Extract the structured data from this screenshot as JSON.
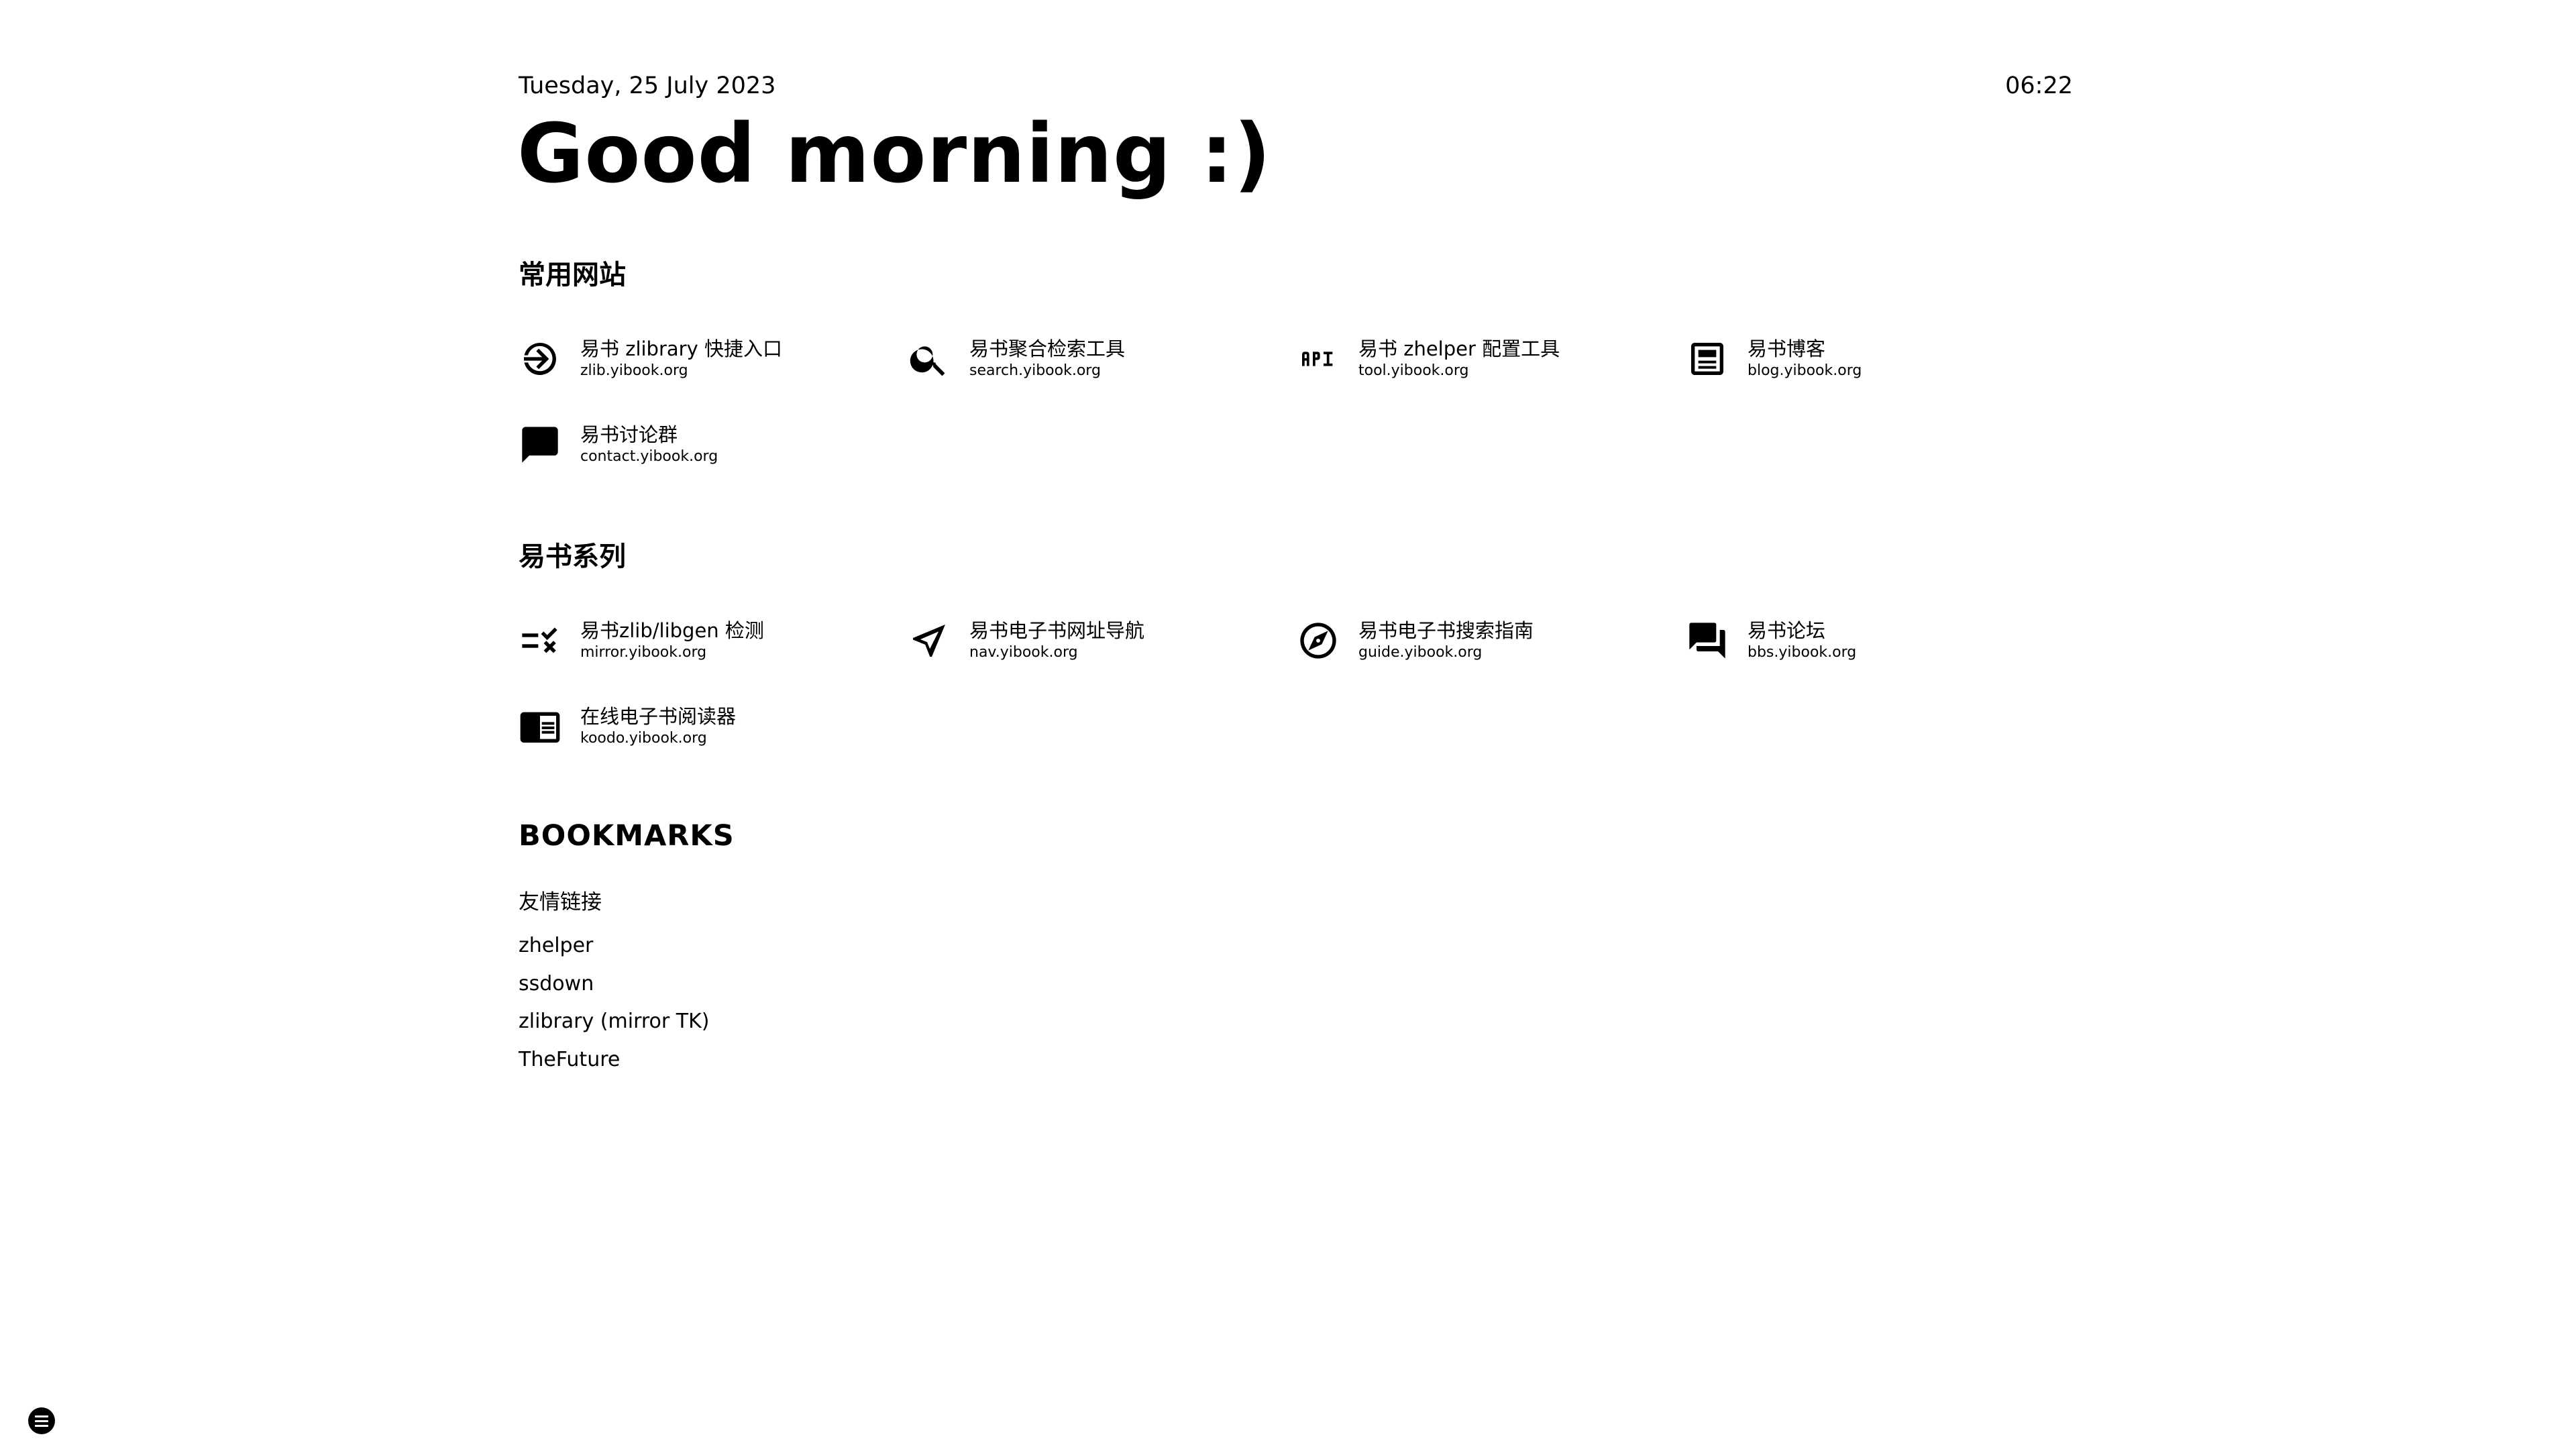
{
  "header": {
    "date": "Tuesday, 25 July 2023",
    "time": "06:22",
    "greeting": "Good morning :)"
  },
  "sections": [
    {
      "title": "常用网站",
      "items": [
        {
          "icon": "login-icon",
          "name": "易书 zlibrary 快捷入口",
          "url": "zlib.yibook.org"
        },
        {
          "icon": "search-icon",
          "name": "易书聚合检索工具",
          "url": "search.yibook.org"
        },
        {
          "icon": "api-icon",
          "name": "易书 zhelper 配置工具",
          "url": "tool.yibook.org"
        },
        {
          "icon": "article-icon",
          "name": "易书博客",
          "url": "blog.yibook.org"
        },
        {
          "icon": "chat-bubble-icon",
          "name": "易书讨论群",
          "url": "contact.yibook.org"
        }
      ]
    },
    {
      "title": "易书系列",
      "items": [
        {
          "icon": "rule-check-icon",
          "name": "易书zlib/libgen 检测",
          "url": "mirror.yibook.org"
        },
        {
          "icon": "send-navigation-icon",
          "name": "易书电子书网址导航",
          "url": "nav.yibook.org"
        },
        {
          "icon": "compass-icon",
          "name": "易书电子书搜索指南",
          "url": "guide.yibook.org"
        },
        {
          "icon": "forum-icon",
          "name": "易书论坛",
          "url": "bbs.yibook.org"
        },
        {
          "icon": "chrome-reader-icon",
          "name": "在线电子书阅读器",
          "url": "koodo.yibook.org"
        }
      ]
    }
  ],
  "bookmarks": {
    "heading": "BOOKMARKS",
    "group": "友情链接",
    "links": [
      "zhelper",
      "ssdown",
      "zlibrary (mirror TK)",
      "TheFuture"
    ]
  },
  "menu_button": {
    "icon": "menu-icon"
  }
}
